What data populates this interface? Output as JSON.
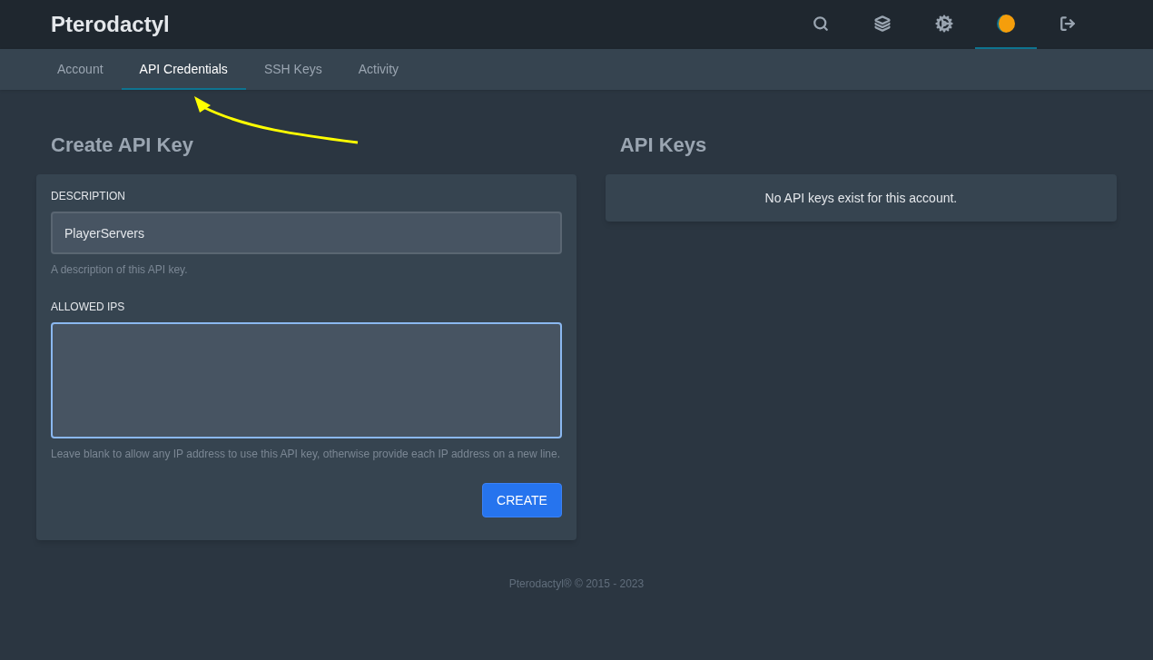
{
  "header": {
    "brand": "Pterodactyl",
    "nav": [
      {
        "kind": "search",
        "selected": false
      },
      {
        "kind": "layers",
        "selected": false
      },
      {
        "kind": "cogs",
        "selected": false
      },
      {
        "kind": "avatar",
        "selected": true
      },
      {
        "kind": "logout",
        "selected": false
      }
    ]
  },
  "tabs": [
    {
      "label": "Account",
      "selected": false
    },
    {
      "label": "API Credentials",
      "selected": true
    },
    {
      "label": "SSH Keys",
      "selected": false
    },
    {
      "label": "Activity",
      "selected": false
    }
  ],
  "create_panel": {
    "title": "Create API Key",
    "fields": [
      {
        "label": "DESCRIPTION",
        "value": "PlayerServers",
        "hint": "A description of this API key.",
        "kind": "input",
        "focused": false
      },
      {
        "label": "ALLOWED IPS",
        "hint": "Leave blank to allow any IP address to use this API key, otherwise provide each IP address on a new line.",
        "kind": "textarea",
        "focused": true
      }
    ],
    "button": "CREATE"
  },
  "keys_panel": {
    "title": "API Keys",
    "empty_message": "No API keys exist for this account."
  },
  "footer": "Pterodactyl® © 2015 - 2023"
}
